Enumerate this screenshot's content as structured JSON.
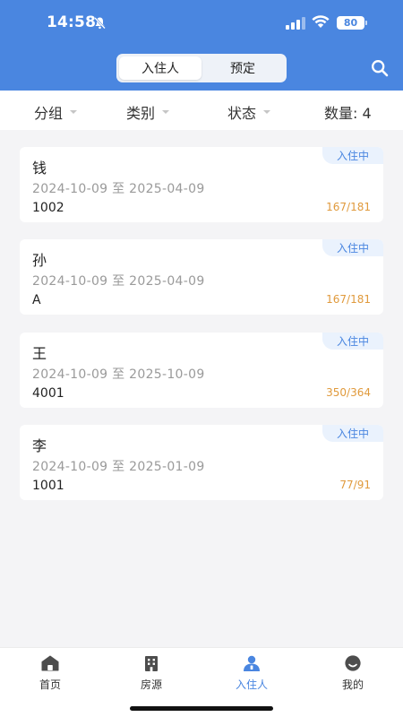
{
  "status": {
    "time": "14:58",
    "battery": "80"
  },
  "header": {
    "tabs": [
      {
        "label": "入住人",
        "active": true
      },
      {
        "label": "预定",
        "active": false
      }
    ]
  },
  "filters": {
    "group": "分组",
    "category": "类别",
    "state": "状态",
    "count_label": "数量: 4"
  },
  "records": [
    {
      "name": "钱",
      "dates": "2024-10-09 至 2025-04-09",
      "room": "1002",
      "ratio": "167/181",
      "status": "入住中"
    },
    {
      "name": "孙",
      "dates": "2024-10-09 至 2025-04-09",
      "room": "A",
      "ratio": "167/181",
      "status": "入住中"
    },
    {
      "name": "王",
      "dates": "2024-10-09 至 2025-10-09",
      "room": "4001",
      "ratio": "350/364",
      "status": "入住中"
    },
    {
      "name": "李",
      "dates": "2024-10-09 至 2025-01-09",
      "room": "1001",
      "ratio": "77/91",
      "status": "入住中"
    }
  ],
  "tabbar": [
    {
      "label": "首页",
      "icon": "home-icon"
    },
    {
      "label": "房源",
      "icon": "building-icon"
    },
    {
      "label": "入住人",
      "icon": "resident-icon",
      "active": true
    },
    {
      "label": "我的",
      "icon": "profile-icon"
    }
  ],
  "colors": {
    "primary": "#4a86e0",
    "accent": "#e09a3c",
    "background": "#f4f4f6"
  }
}
